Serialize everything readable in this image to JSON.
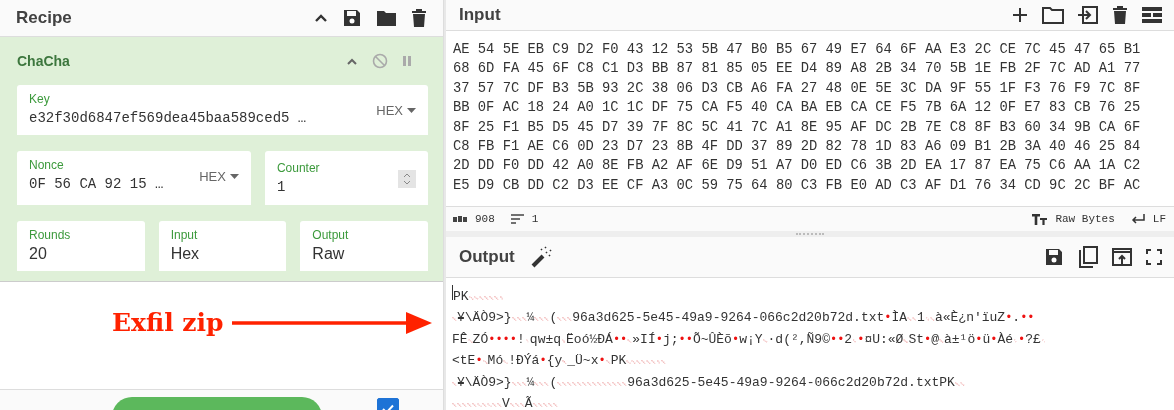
{
  "recipe": {
    "title": "Recipe",
    "operation": {
      "name": "ChaCha",
      "arguments": [
        {
          "kind": "wide",
          "label": "Key",
          "value": "e32f30d6847ef569dea45baa589ced5 …",
          "type": "HEX"
        },
        {
          "kind": "typed",
          "label": "Nonce",
          "value": "0F 56 CA 92 15 …",
          "type": "HEX"
        },
        {
          "kind": "number",
          "label": "Counter",
          "value": "1"
        },
        {
          "kind": "plain",
          "label": "Rounds",
          "value": "20"
        },
        {
          "kind": "plain",
          "label": "Input",
          "value": "Hex"
        },
        {
          "kind": "plain",
          "label": "Output",
          "value": "Raw"
        }
      ]
    },
    "auto_bake": {
      "checked": true
    }
  },
  "annotation": {
    "text": "Exfil zip"
  },
  "input": {
    "title": "Input",
    "lines": [
      "AE 54 5E EB C9 D2 F0 43 12 53 5B 47 B0 B5 67 49 E7 64 6F AA E3 2C CE 7C 45 47 65 B1",
      "68 6D FA 45 6F C8 C1 D3 BB 87 81 85 05 EE D4 89 A8 2B 34 70 5B 1E FB 2F 7C AD A1 77",
      "37 57 7C DF B3 5B 93 2C 38 06 D3 CB A6 FA 27 48 0E 5E 3C DA 9F 55 1F F3 76 F9 7C 8F",
      "BB 0F AC 18 24 A0 1C 1C DF 75 CA F5 40 CA BA EB CA CE F5 7B 6A 12 0F E7 83 CB 76 25",
      "8F 25 F1 B5 D5 45 D7 39 7F 8C 5C 41 7C A1 8E 95 AF DC 2B 7E C8 8F B3 60 34 9B CA 6F",
      "C8 FB F1 AE C6 0D 23 D7 23 8B 4F DD 37 89 2D 82 78 1D 83 A6 09 B1 2B 3A 40 46 25 84",
      "2D DD F0 DD 42 A0 8E FB A2 AF 6E D9 51 A7 D0 ED C6 3B 2D EA 17 87 EA 75 C6 AA 1A C2",
      "E5 D9 CB DD C2 D3 EE CF A3 0C 59 75 64 80 C3 FB E0 AD C3 AF D1 76 34 CD 9C 2C BF AC"
    ],
    "status": {
      "length": "908",
      "lines": "1",
      "encoding": "Raw Bytes",
      "eol": "LF"
    }
  },
  "output": {
    "title": "Output",
    "lines": [
      [
        {
          "kind": "text",
          "text": "PK"
        },
        {
          "kind": "ctrl",
          "text": "␃␄␔␀␀␀␈"
        }
      ],
      [
        {
          "kind": "ctrl",
          "text": "␀"
        },
        {
          "kind": "text",
          "text": "¥\\ÄÒ9>}"
        },
        {
          "kind": "ctrl",
          "text": "␀␀␀"
        },
        {
          "kind": "text",
          "text": "¼"
        },
        {
          "kind": "ctrl",
          "text": "␀␀␀"
        },
        {
          "kind": "text",
          "text": "("
        },
        {
          "kind": "ctrl",
          "text": "␀␀␀"
        },
        {
          "kind": "text",
          "text": "96a3d625-5e45-49a9-9264-066c2d20b72d.txt"
        },
        {
          "kind": "dot",
          "text": "•"
        },
        {
          "kind": "text",
          "text": "ÌA"
        },
        {
          "kind": "ctrl",
          "text": "␐␑"
        },
        {
          "kind": "text",
          "text": "1"
        },
        {
          "kind": "ctrl",
          "text": "␜␆"
        },
        {
          "kind": "text",
          "text": "à«È¿n'ïuZ"
        },
        {
          "kind": "dot",
          "text": "•"
        },
        {
          "kind": "text",
          "text": "."
        },
        {
          "kind": "dot",
          "text": "••"
        }
      ],
      [
        {
          "kind": "text",
          "text": "FÊ"
        },
        {
          "kind": "ctrl",
          "text": "␖"
        },
        {
          "kind": "text",
          "text": "ZÓ"
        },
        {
          "kind": "dot",
          "text": "••••"
        },
        {
          "kind": "text",
          "text": "!"
        },
        {
          "kind": "ctrl",
          "text": "␏"
        },
        {
          "kind": "text",
          "text": "qw±q"
        },
        {
          "kind": "ctrl",
          "text": "␎"
        },
        {
          "kind": "text",
          "text": "Ëoó½ÐÁ"
        },
        {
          "kind": "dot",
          "text": "••"
        },
        {
          "kind": "ctrl",
          "text": "␓"
        },
        {
          "kind": "text",
          "text": "»IÍ"
        },
        {
          "kind": "dot",
          "text": "•"
        },
        {
          "kind": "text",
          "text": "j;"
        },
        {
          "kind": "dot",
          "text": "••"
        },
        {
          "kind": "text",
          "text": "Õ~ÛÈõ"
        },
        {
          "kind": "dot",
          "text": "•"
        },
        {
          "kind": "text",
          "text": "w¡Y"
        },
        {
          "kind": "ctrl",
          "text": "␄"
        },
        {
          "kind": "text",
          "text": "·d(²,Ñ9©"
        },
        {
          "kind": "dot",
          "text": "••"
        },
        {
          "kind": "text",
          "text": "2"
        },
        {
          "kind": "ctrl",
          "text": "␙"
        },
        {
          "kind": "dot",
          "text": "•"
        },
        {
          "kind": "text",
          "text": "¤U:«Ø"
        },
        {
          "kind": "ctrl",
          "text": "␚"
        },
        {
          "kind": "text",
          "text": "St"
        },
        {
          "kind": "dot",
          "text": "•"
        },
        {
          "kind": "text",
          "text": "@"
        },
        {
          "kind": "ctrl",
          "text": "␕"
        },
        {
          "kind": "text",
          "text": "à±¹ö"
        },
        {
          "kind": "dot",
          "text": "•"
        },
        {
          "kind": "text",
          "text": "ü"
        },
        {
          "kind": "dot",
          "text": "•"
        },
        {
          "kind": "text",
          "text": "Àé"
        },
        {
          "kind": "ctrl",
          "text": "␌"
        },
        {
          "kind": "dot",
          "text": "•"
        },
        {
          "kind": "text",
          "text": "?£"
        },
        {
          "kind": "ctrl",
          "text": "␋"
        }
      ],
      [
        {
          "kind": "text",
          "text": "<tE"
        },
        {
          "kind": "dot",
          "text": "•"
        },
        {
          "kind": "ctrl",
          "text": "␗"
        },
        {
          "kind": "text",
          "text": "Mó"
        },
        {
          "kind": "ctrl",
          "text": "␁"
        },
        {
          "kind": "text",
          "text": "!ÐÝá"
        },
        {
          "kind": "dot",
          "text": "•"
        },
        {
          "kind": "text",
          "text": "{y"
        },
        {
          "kind": "ctrl",
          "text": "␇"
        },
        {
          "kind": "text",
          "text": "_Ü~x"
        },
        {
          "kind": "dot",
          "text": "•"
        },
        {
          "kind": "ctrl",
          "text": "␀"
        },
        {
          "kind": "text",
          "text": "PK"
        },
        {
          "kind": "ctrl",
          "text": "␁␂␔␀␔␀␈␀"
        }
      ],
      [
        {
          "kind": "ctrl",
          "text": "␀"
        },
        {
          "kind": "text",
          "text": "¥\\ÄÒ9>}"
        },
        {
          "kind": "ctrl",
          "text": "␀␀␀"
        },
        {
          "kind": "text",
          "text": "¼"
        },
        {
          "kind": "ctrl",
          "text": "␀␀␀"
        },
        {
          "kind": "text",
          "text": "("
        },
        {
          "kind": "ctrl",
          "text": "␀␀␀␀␀␀␀␀␀␀␀␀␀␀"
        },
        {
          "kind": "text",
          "text": "96a3d625-5e45-49a9-9264-066c2d20b72d.txtPK"
        },
        {
          "kind": "ctrl",
          "text": "␅␆"
        }
      ],
      [
        {
          "kind": "ctrl",
          "text": "␀␀␀␀␀␁␀␁␀␀"
        },
        {
          "kind": "text",
          "text": "V"
        },
        {
          "kind": "ctrl",
          "text": "␀␀␀"
        },
        {
          "kind": "text",
          "text": "Ã"
        },
        {
          "kind": "ctrl",
          "text": "␀␀␀␀␀"
        }
      ]
    ]
  }
}
